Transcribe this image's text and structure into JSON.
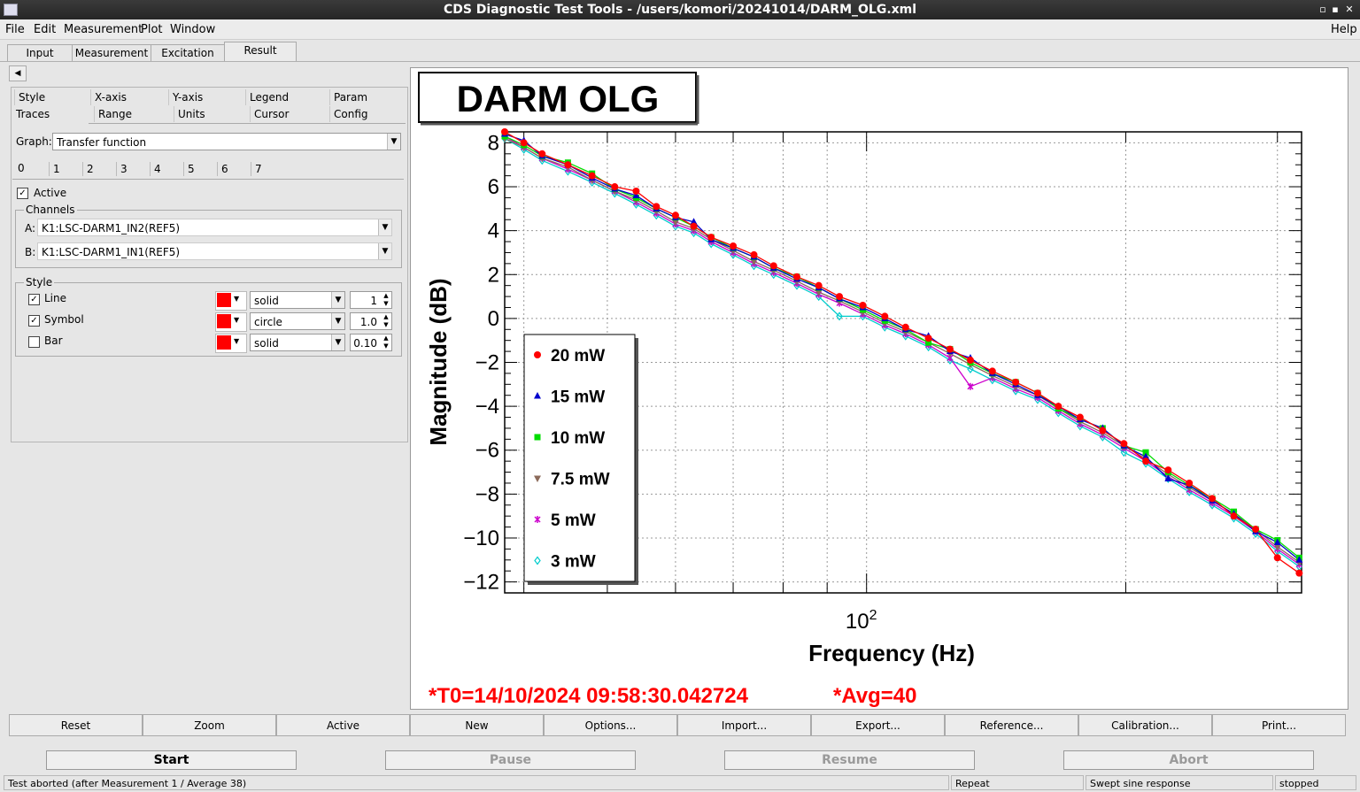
{
  "window": {
    "title": "CDS Diagnostic Test Tools - /users/komori/20241014/DARM_OLG.xml"
  },
  "menu": {
    "items": [
      "File",
      "Edit",
      "Measurement",
      "Plot",
      "Window"
    ],
    "help": "Help"
  },
  "main_tabs": [
    "Input",
    "Measurement",
    "Excitation",
    "Result"
  ],
  "selected_main_tab": "Result",
  "sub_tabs_row1": [
    "Style",
    "X-axis",
    "Y-axis",
    "Legend",
    "Param"
  ],
  "sub_tabs_row2": [
    "Traces",
    "Range",
    "Units",
    "Cursor",
    "Config"
  ],
  "graph": {
    "label": "Graph:",
    "value": "Transfer function"
  },
  "trace_tabs": [
    "0",
    "1",
    "2",
    "3",
    "4",
    "5",
    "6",
    "7"
  ],
  "active": {
    "label": "Active",
    "checked": true
  },
  "channels": {
    "group_label": "Channels",
    "a_label": "A:",
    "a_value": "K1:LSC-DARM1_IN2(REF5)",
    "b_label": "B:",
    "b_value": "K1:LSC-DARM1_IN1(REF5)"
  },
  "style": {
    "group_label": "Style",
    "line": {
      "label": "Line",
      "checked": true,
      "color": "#ff0000",
      "style": "solid",
      "value": "1"
    },
    "symbol": {
      "label": "Symbol",
      "checked": true,
      "color": "#ff0000",
      "style": "circle",
      "value": "1.0"
    },
    "bar": {
      "label": "Bar",
      "checked": false,
      "color": "#ff0000",
      "style": "solid",
      "value": "0.10"
    }
  },
  "plot": {
    "title": "DARM OLG",
    "t0_label": "*T0=14/10/2024 09:58:30.042724",
    "avg_label": "*Avg=40",
    "annotation_color": "#ff0000"
  },
  "chart_data": {
    "type": "line",
    "title": "DARM OLG",
    "xlabel": "Frequency (Hz)",
    "ylabel": "Magnitude (dB)",
    "x_scale": "log",
    "xlim": [
      38,
      320
    ],
    "ylim": [
      -12.5,
      8.5
    ],
    "x_tick_labels": [
      "10^2"
    ],
    "y_ticks": [
      8,
      6,
      4,
      2,
      0,
      -2,
      -4,
      -6,
      -8,
      -10,
      -12
    ],
    "y_tick_labels": [
      "8",
      "6",
      "4",
      "2",
      "0",
      "−2",
      "−4",
      "−6",
      "−8",
      "−10",
      "−12"
    ],
    "grid": true,
    "legend_position": "center-left",
    "x": [
      38,
      40,
      42,
      45,
      48,
      51,
      54,
      57,
      60,
      63,
      66,
      70,
      74,
      78,
      83,
      88,
      93,
      99,
      105,
      111,
      118,
      125,
      132,
      140,
      149,
      158,
      167,
      177,
      188,
      199,
      211,
      224,
      237,
      252,
      267,
      283,
      300,
      318
    ],
    "series": [
      {
        "name": "20 mW",
        "color": "#ff0000",
        "marker": "circle",
        "values": [
          8.5,
          8.0,
          7.5,
          7.0,
          6.5,
          6.0,
          5.8,
          5.1,
          4.7,
          4.2,
          3.7,
          3.3,
          2.9,
          2.4,
          1.9,
          1.5,
          1.0,
          0.6,
          0.1,
          -0.4,
          -0.9,
          -1.4,
          -1.9,
          -2.4,
          -2.9,
          -3.4,
          -4.0,
          -4.5,
          -5.1,
          -5.7,
          -6.5,
          -6.9,
          -7.5,
          -8.2,
          -9.0,
          -9.6,
          -10.9,
          -11.6
        ]
      },
      {
        "name": "15 mW",
        "color": "#0000cc",
        "marker": "triangle-up",
        "values": [
          8.4,
          8.1,
          7.4,
          7.0,
          6.4,
          5.9,
          5.6,
          5.0,
          4.6,
          4.4,
          3.6,
          3.2,
          2.8,
          2.3,
          1.8,
          1.4,
          0.9,
          0.5,
          0.0,
          -0.5,
          -0.8,
          -1.5,
          -1.8,
          -2.5,
          -3.0,
          -3.5,
          -4.0,
          -4.6,
          -5.0,
          -5.8,
          -6.3,
          -7.3,
          -7.6,
          -8.3,
          -8.9,
          -9.7,
          -10.2,
          -11.0
        ]
      },
      {
        "name": "10 mW",
        "color": "#00dd00",
        "marker": "square",
        "values": [
          8.3,
          7.9,
          7.4,
          7.1,
          6.6,
          5.9,
          5.5,
          5.0,
          4.6,
          4.2,
          3.7,
          3.2,
          2.8,
          2.3,
          1.9,
          1.4,
          0.9,
          0.4,
          -0.1,
          -0.5,
          -1.1,
          -1.4,
          -2.0,
          -2.5,
          -2.9,
          -3.4,
          -4.1,
          -4.6,
          -5.0,
          -5.8,
          -6.1,
          -7.0,
          -7.6,
          -8.2,
          -8.8,
          -9.6,
          -10.1,
          -10.9
        ]
      },
      {
        "name": "7.5 mW",
        "color": "#8b6a5a",
        "marker": "triangle-down",
        "values": [
          8.2,
          7.8,
          7.3,
          6.9,
          6.3,
          5.8,
          5.4,
          4.9,
          4.4,
          4.1,
          3.6,
          3.1,
          2.6,
          2.2,
          1.7,
          1.2,
          0.8,
          0.3,
          -0.2,
          -0.6,
          -1.1,
          -1.6,
          -2.1,
          -2.6,
          -3.1,
          -3.5,
          -4.1,
          -4.7,
          -5.2,
          -5.8,
          -6.4,
          -7.1,
          -7.7,
          -8.3,
          -8.9,
          -9.6,
          -10.4,
          -11.1
        ]
      },
      {
        "name": "5 mW",
        "color": "#cc00cc",
        "marker": "star",
        "values": [
          8.3,
          7.8,
          7.3,
          6.8,
          6.3,
          5.8,
          5.3,
          4.8,
          4.3,
          4.0,
          3.5,
          3.0,
          2.5,
          2.1,
          1.6,
          1.1,
          0.7,
          0.2,
          -0.3,
          -0.7,
          -1.2,
          -1.8,
          -3.1,
          -2.7,
          -3.2,
          -3.6,
          -4.2,
          -4.8,
          -5.3,
          -5.9,
          -6.5,
          -7.2,
          -7.8,
          -8.4,
          -9.0,
          -9.7,
          -10.5,
          -11.2
        ]
      },
      {
        "name": "3 mW",
        "color": "#00cccc",
        "marker": "diamond-open",
        "values": [
          8.2,
          7.7,
          7.2,
          6.7,
          6.2,
          5.7,
          5.2,
          4.7,
          4.2,
          3.9,
          3.4,
          2.9,
          2.4,
          2.0,
          1.5,
          1.0,
          0.1,
          0.1,
          -0.4,
          -0.8,
          -1.3,
          -1.9,
          -2.3,
          -2.8,
          -3.3,
          -3.7,
          -4.3,
          -4.9,
          -5.4,
          -6.1,
          -6.6,
          -7.3,
          -7.9,
          -8.5,
          -9.1,
          -9.8,
          -10.6,
          -11.3
        ]
      }
    ]
  },
  "bottom_buttons": [
    "Reset",
    "Zoom",
    "Active",
    "New",
    "Options...",
    "Import...",
    "Export...",
    "Reference...",
    "Calibration...",
    "Print..."
  ],
  "run_buttons": [
    "Start",
    "Pause",
    "Resume",
    "Abort"
  ],
  "status": {
    "message": "Test aborted (after Measurement 1 / Average 38)",
    "repeat": "Repeat",
    "type": "Swept sine response",
    "state": "stopped"
  }
}
